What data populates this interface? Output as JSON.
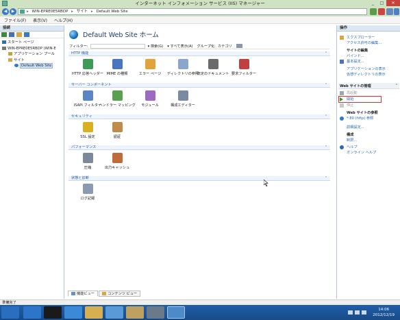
{
  "window": {
    "title": "インターネット インフォメーション サービス (IIS) マネージャー",
    "controls": [
      "_",
      "□",
      "✕"
    ]
  },
  "address": {
    "crumbs": [
      "WIN-EPRE0E5RBDP",
      "サイト",
      "Default Web Site"
    ],
    "separator": "▸"
  },
  "menu": [
    "ファイル(F)",
    "表示(V)",
    "ヘルプ(H)"
  ],
  "connections": {
    "title": "接続",
    "tree": [
      {
        "label": "スタート ページ",
        "indent": 1,
        "icon": "start-page-icon"
      },
      {
        "label": "WIN-EPRE0E5RBDP (WIN-E",
        "indent": 1,
        "icon": "server-icon"
      },
      {
        "label": "アプリケーション プール",
        "indent": 2,
        "icon": "app-pool-icon"
      },
      {
        "label": "サイト",
        "indent": 2,
        "icon": "sites-folder-icon"
      },
      {
        "label": "Default Web Site",
        "indent": 3,
        "icon": "globe-icon",
        "selected": true
      }
    ]
  },
  "center": {
    "title": "Default Web Site ホーム",
    "filter": {
      "label": "フィルター:",
      "search": "▾ 検索(G)",
      "show_all": "▾ すべて表示(A)",
      "group": "グループ化:",
      "group_value": "カテゴリ"
    },
    "groups": [
      {
        "name": "HTTP 機能",
        "items": [
          {
            "label": "HTTP 応答ヘッダー",
            "icon": "http-response-headers-icon",
            "color": "#3e9a57"
          },
          {
            "label": "MIME の種類",
            "icon": "mime-types-icon",
            "color": "#4a76c0"
          },
          {
            "label": "エラー ページ",
            "icon": "error-pages-icon",
            "color": "#e0a43a"
          },
          {
            "label": "ディレクトリの参照",
            "icon": "directory-browsing-icon",
            "color": "#8aa6cc"
          },
          {
            "label": "既定のドキュメント",
            "icon": "default-document-icon",
            "color": "#6b6b6b"
          },
          {
            "label": "要求フィルター",
            "icon": "request-filtering-icon",
            "color": "#c04040"
          }
        ]
      },
      {
        "name": "サーバー コンポーネント",
        "items": [
          {
            "label": "ISAPI フィルター",
            "icon": "isapi-filters-icon",
            "color": "#5a86c5"
          },
          {
            "label": "ハンドラー マッピング",
            "icon": "handler-mappings-icon",
            "color": "#5aa050"
          },
          {
            "label": "モジュール",
            "icon": "modules-icon",
            "color": "#9a6bc0"
          },
          {
            "label": "構成エディター",
            "icon": "configuration-editor-icon",
            "color": "#7b8aa0"
          }
        ]
      },
      {
        "name": "セキュリティ",
        "items": [
          {
            "label": "SSL 設定",
            "icon": "ssl-settings-icon",
            "color": "#d8b020"
          },
          {
            "label": "認証",
            "icon": "authentication-icon",
            "color": "#c08a4a"
          }
        ]
      },
      {
        "name": "パフォーマンス",
        "items": [
          {
            "label": "圧縮",
            "icon": "compression-icon",
            "color": "#7a8a9a"
          },
          {
            "label": "出力キャッシュ",
            "icon": "output-caching-icon",
            "color": "#c06a3a"
          }
        ]
      },
      {
        "name": "状態と診断",
        "items": [
          {
            "label": "ログ記録",
            "icon": "logging-icon",
            "color": "#8a9ab0"
          }
        ]
      }
    ],
    "tabs": [
      "機能ビュー",
      "コンテンツ ビュー"
    ]
  },
  "actions": {
    "title": "操作",
    "explore": "エクスプローラー",
    "edit_permissions": "アクセス許可の編集...",
    "site_edit_head": "サイトの編集",
    "bindings": "バインド...",
    "basic_settings": "基本設定...",
    "view_applications": "アプリケーションの表示",
    "view_virtual_dirs": "仮想ディレクトリの表示",
    "manage_head": "Web サイトの管理",
    "restart": "再起動",
    "start": "開始",
    "stop": "停止",
    "browse_head": "Web サイトの参照",
    "browse_port": "*:80 (http) 参照",
    "advanced_settings": "詳細設定...",
    "config_head": "構成",
    "limits": "制限...",
    "help": "ヘルプ",
    "online_help": "オンライン ヘルプ"
  },
  "status": {
    "text": "準備完了"
  },
  "taskbar": {
    "time": "14:06",
    "date": "2012/12/19"
  }
}
